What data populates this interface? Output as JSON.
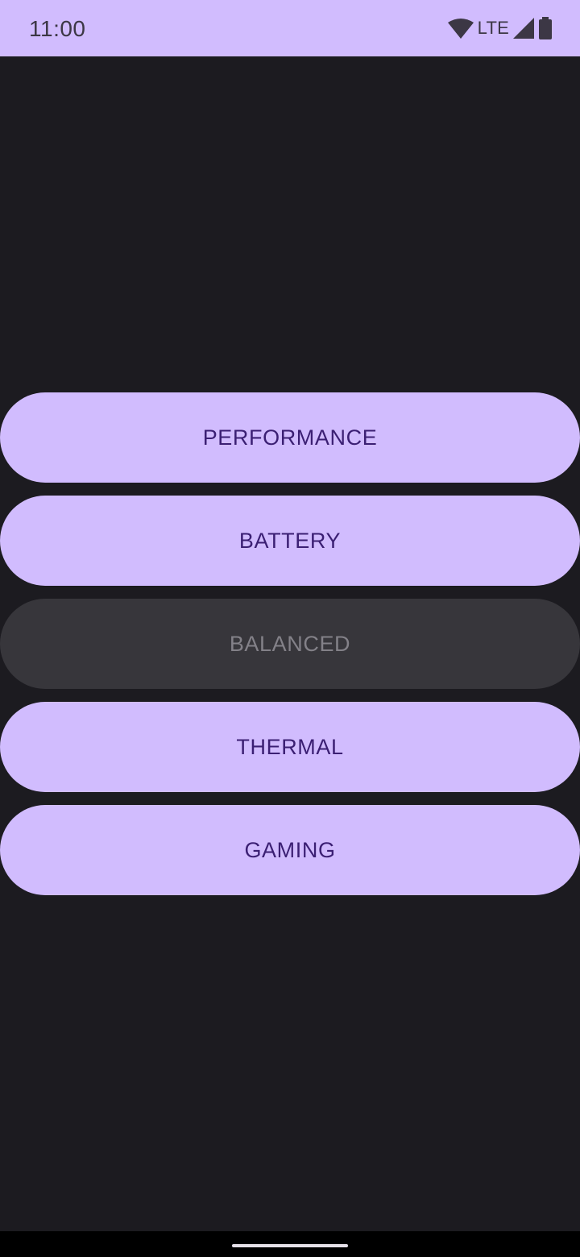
{
  "status_bar": {
    "time": "11:00",
    "network_label": "LTE",
    "icons": [
      "wifi-icon",
      "signal-icon",
      "battery-icon"
    ]
  },
  "buttons": [
    {
      "label": "PERFORMANCE",
      "enabled": true
    },
    {
      "label": "BATTERY",
      "enabled": true
    },
    {
      "label": "BALANCED",
      "enabled": false
    },
    {
      "label": "THERMAL",
      "enabled": true
    },
    {
      "label": "GAMING",
      "enabled": true
    }
  ],
  "colors": {
    "background": "#1c1b20",
    "button_fill": "#d1bcfe",
    "button_text": "#3b1f73",
    "disabled_fill": "#37363b",
    "disabled_text": "#838188"
  }
}
